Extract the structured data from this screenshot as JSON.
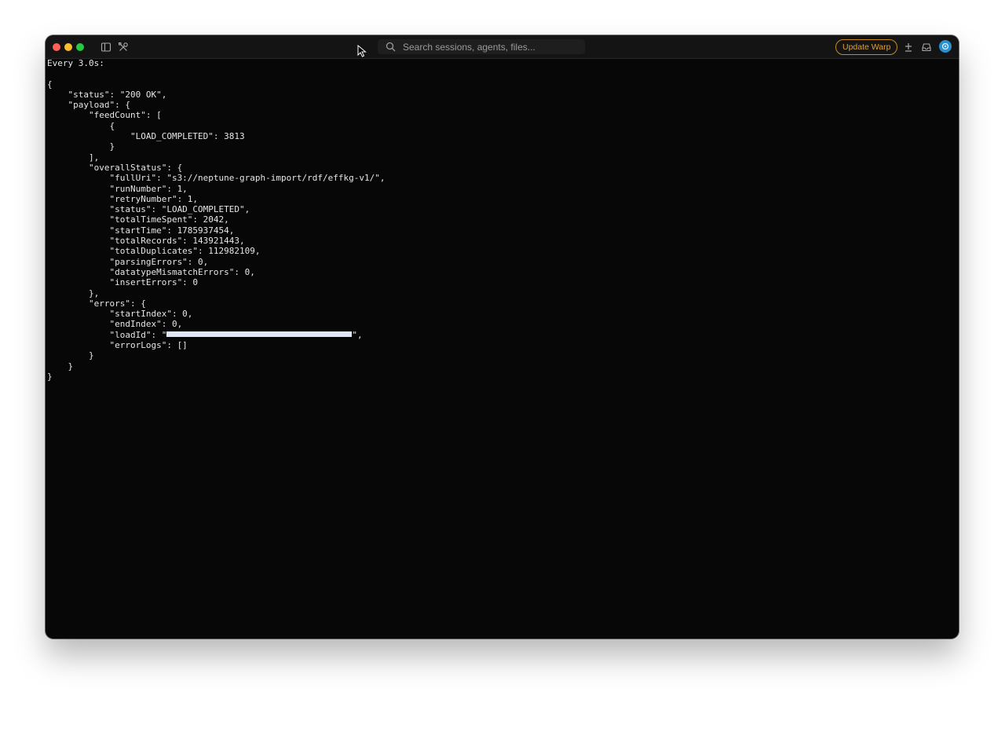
{
  "toolbar": {
    "search_placeholder": "Search sessions, agents, files...",
    "update_button_label": "Update Warp",
    "icons": [
      "sidebar-toggle-icon",
      "tools-icon",
      "search-icon",
      "add-pane-icon",
      "inbox-icon",
      "settings-icon"
    ]
  },
  "colors": {
    "window_background": "#070707",
    "titlebar_background": "#141414",
    "terminal_text": "#e6e6e6",
    "update_accent": "#e2a132",
    "avatar": "#2b8fcf",
    "redaction": "#dfe7f4"
  },
  "terminal": {
    "header": "Every 3.0s:",
    "lines": [
      "{",
      "    \"status\": \"200 OK\",",
      "    \"payload\": {",
      "        \"feedCount\": [",
      "            {",
      "                \"LOAD_COMPLETED\": 3813",
      "            }",
      "        ],",
      "        \"overallStatus\": {",
      "            \"fullUri\": \"s3://neptune-graph-import/rdf/effkg-v1/\",",
      "            \"runNumber\": 1,",
      "            \"retryNumber\": 1,",
      "            \"status\": \"LOAD_COMPLETED\",",
      "            \"totalTimeSpent\": 2042,",
      "            \"startTime\": 1785937454,",
      "            \"totalRecords\": 143921443,",
      "            \"totalDuplicates\": 112982109,",
      "            \"parsingErrors\": 0,",
      "            \"datatypeMismatchErrors\": 0,",
      "            \"insertErrors\": 0",
      "        },",
      "        \"errors\": {",
      "            \"startIndex\": 0,",
      "            \"endIndex\": 0,"
    ],
    "loadid_line": {
      "prefix": "            \"loadId\": \"",
      "suffix": "\","
    },
    "closing_lines": [
      "            \"errorLogs\": []",
      "        }",
      "    }",
      "}"
    ]
  }
}
